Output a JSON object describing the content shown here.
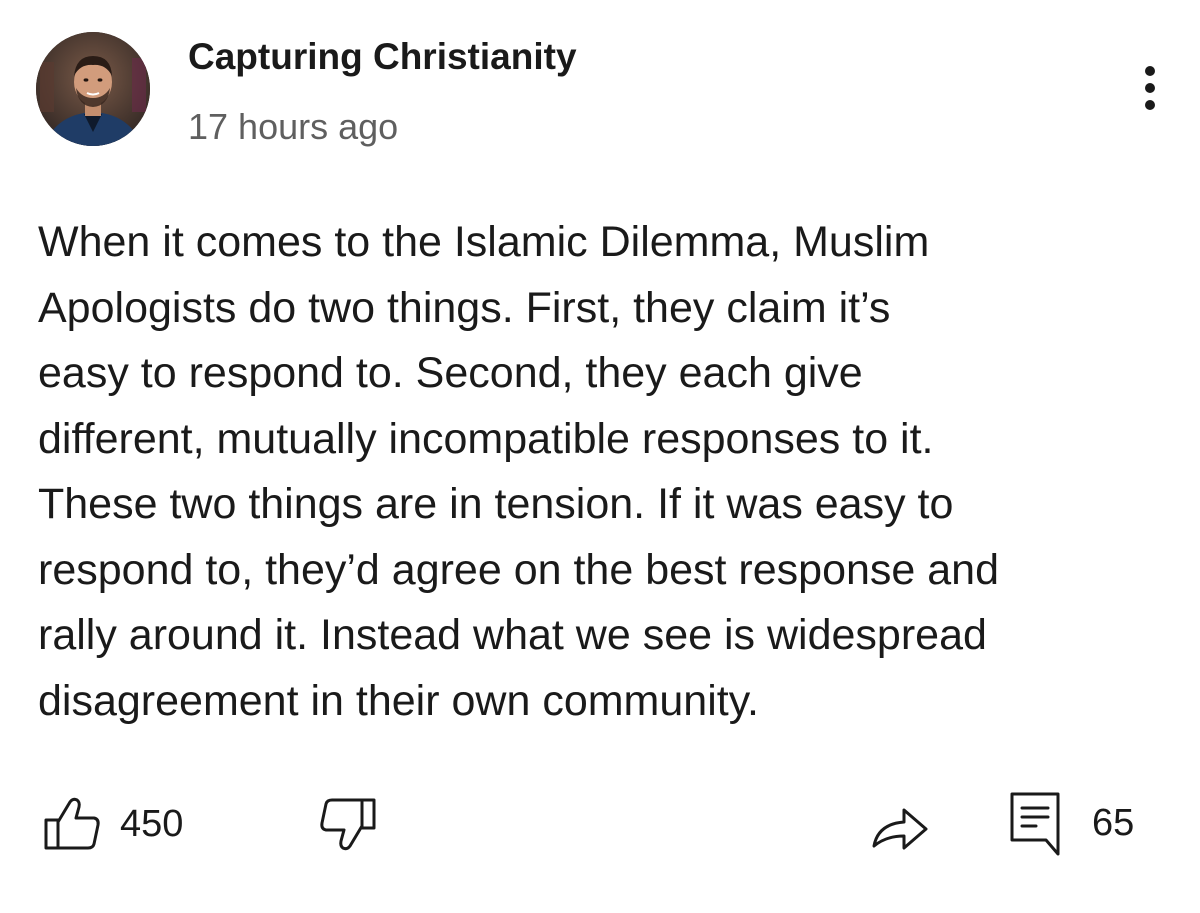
{
  "post": {
    "channel_name": "Capturing Christianity",
    "timestamp": "17 hours ago",
    "body_lines": [
      "When it comes to the Islamic Dilemma, Muslim",
      "Apologists do two things. First, they claim it’s",
      "easy to respond to. Second, they each give",
      "different, mutually incompatible responses to it.",
      "These two things are in tension. If it was easy to",
      "respond to, they’d agree on the best response and",
      "rally around it. Instead what we see is widespread",
      "disagreement in their own community."
    ]
  },
  "actions": {
    "like_count": "450",
    "comment_count": "65"
  },
  "icons": {
    "avatar": "avatar",
    "more": "more-vertical-icon",
    "like": "thumbs-up-icon",
    "dislike": "thumbs-down-icon",
    "share": "share-arrow-icon",
    "comments": "comment-icon"
  }
}
